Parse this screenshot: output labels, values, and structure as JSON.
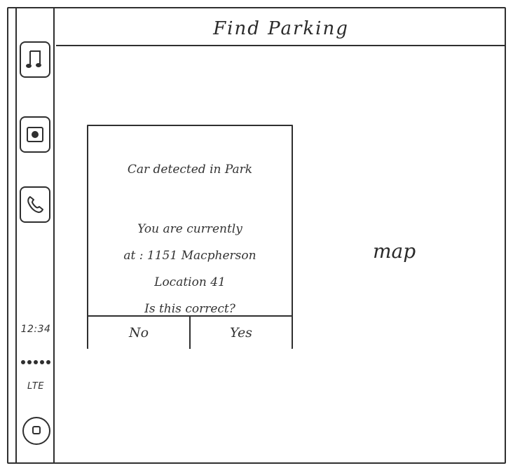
{
  "header": {
    "title": "Find Parking"
  },
  "sidebar": {
    "icons": [
      {
        "name": "music-icon"
      },
      {
        "name": "media-icon"
      },
      {
        "name": "phone-icon"
      }
    ],
    "status": {
      "time": "12:34",
      "lte": "LTE"
    }
  },
  "map": {
    "label": "map"
  },
  "dialog": {
    "title": "Car detected in Park",
    "message_lines": [
      "You are currently",
      "at : 1151 Macpherson",
      "Location 41",
      "Is this correct?"
    ],
    "buttons": {
      "no": "No",
      "yes": "Yes"
    }
  }
}
